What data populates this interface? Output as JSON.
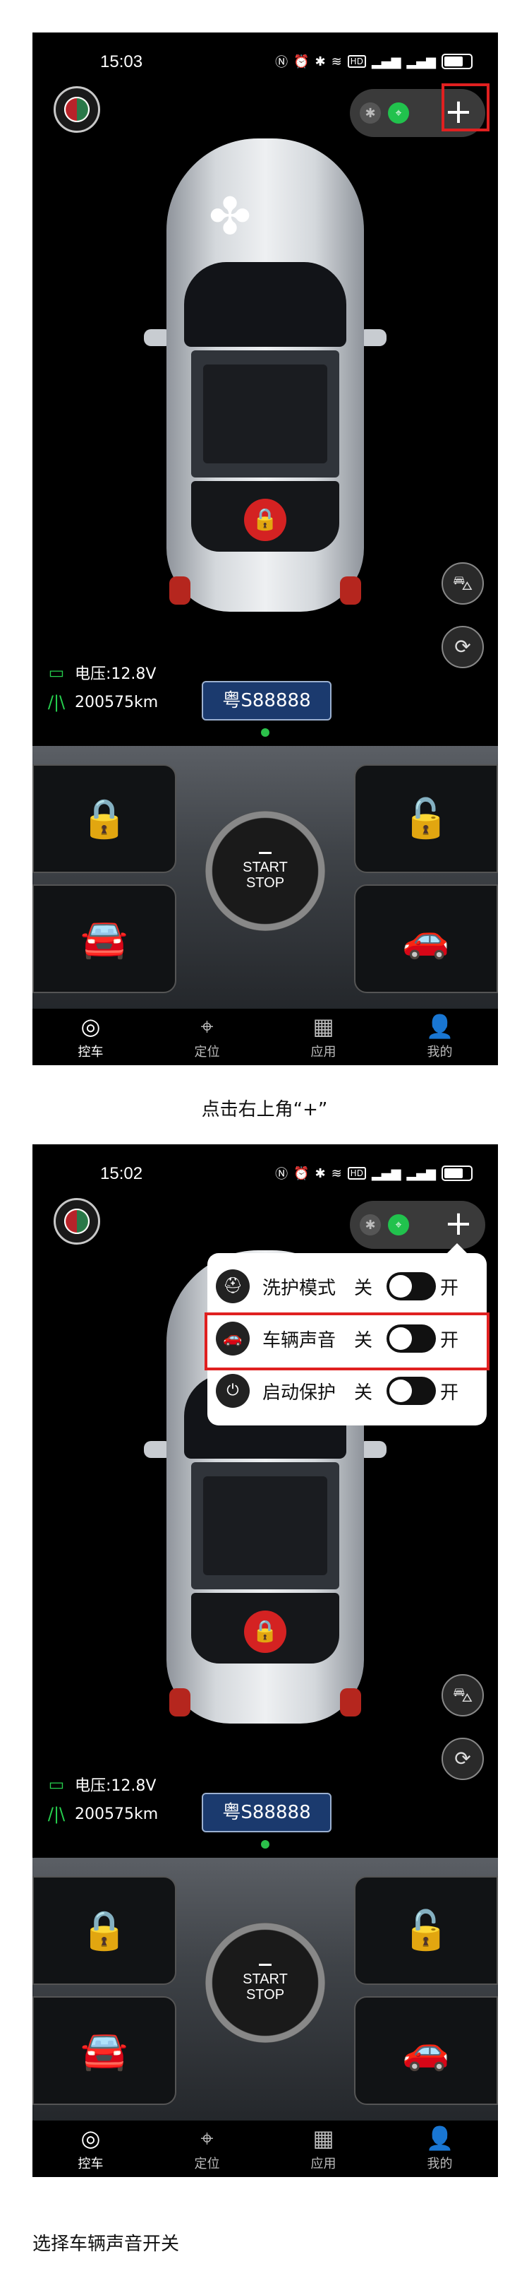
{
  "screens": [
    {
      "time": "15:03",
      "status_icons": [
        "nfc-icon",
        "alarm-icon",
        "bluetooth-icon",
        "wifi-icon",
        "HD",
        "signal-icon",
        "signal-icon",
        "battery-icon"
      ],
      "voltage": "电压:12.8V",
      "mileage": "200575km",
      "plate": "粤S88888",
      "start_line1": "START",
      "start_line2": "STOP",
      "tabs": [
        "控车",
        "定位",
        "应用",
        "我的"
      ]
    },
    {
      "time": "15:02",
      "status_icons": [
        "nfc-icon",
        "alarm-icon",
        "bluetooth-icon",
        "wifi-icon",
        "HD",
        "signal-icon",
        "signal-icon",
        "battery-icon"
      ],
      "voltage": "电压:12.8V",
      "mileage": "200575km",
      "plate": "粤S88888",
      "start_line1": "START",
      "start_line2": "STOP",
      "tabs": [
        "控车",
        "定位",
        "应用",
        "我的"
      ],
      "popup": [
        {
          "label": "洗护模式",
          "off": "关",
          "on": "开",
          "icon": "wash-person-icon"
        },
        {
          "label": "车辆声音",
          "off": "关",
          "on": "开",
          "icon": "car-sound-icon"
        },
        {
          "label": "启动保护",
          "off": "关",
          "on": "开",
          "icon": "start-stop-icon"
        }
      ]
    }
  ],
  "captions": [
    "点击右上角“+”",
    "选择车辆声音开关"
  ],
  "accent_green": "#21c24d",
  "highlight_red": "#e02020"
}
